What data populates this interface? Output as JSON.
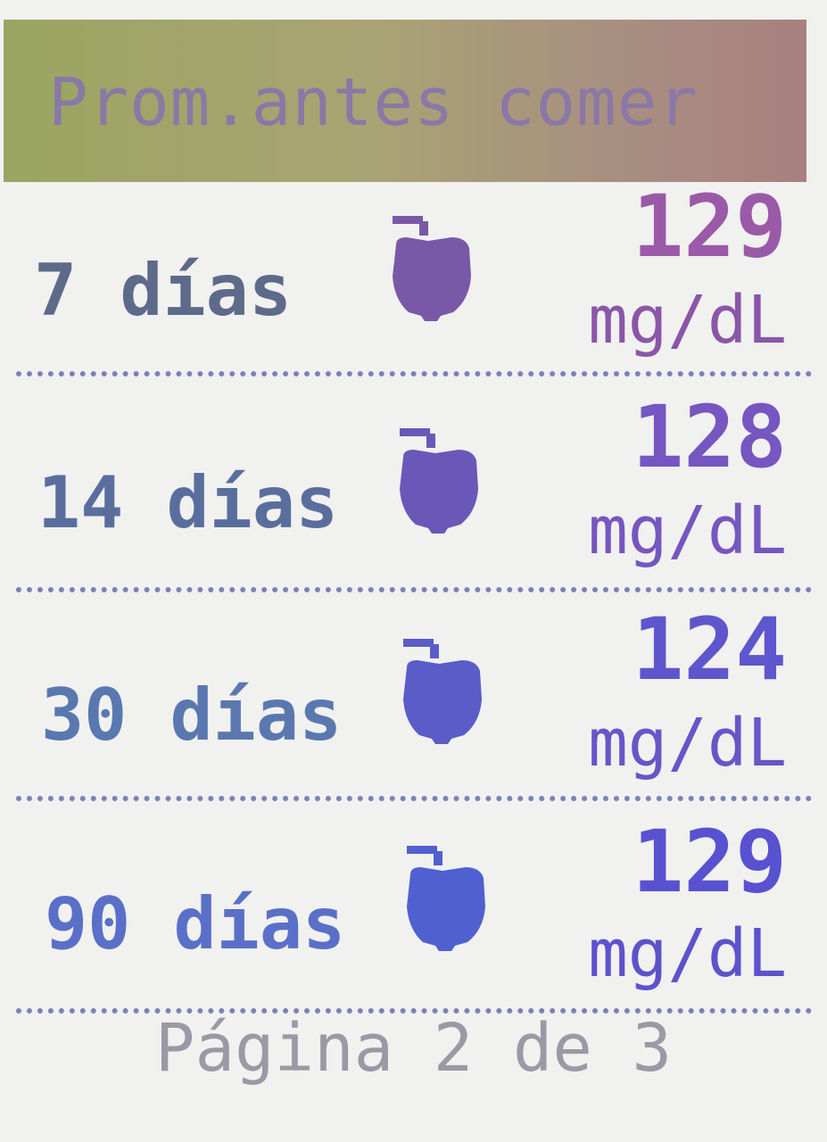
{
  "header": {
    "title": "Prom.antes comer"
  },
  "rows": [
    {
      "period": "7 días",
      "value": "129",
      "unit": "mg/dL",
      "icon": "apple-icon"
    },
    {
      "period": "14 días",
      "value": "128",
      "unit": "mg/dL",
      "icon": "apple-icon"
    },
    {
      "period": "30 días",
      "value": "124",
      "unit": "mg/dL",
      "icon": "apple-icon"
    },
    {
      "period": "90 días",
      "value": "129",
      "unit": "mg/dL",
      "icon": "apple-icon"
    }
  ],
  "footer": {
    "page_indicator": "Página 2 de 3"
  },
  "colors": {
    "header_start": "#9aa561",
    "header_end": "#a8807f",
    "label_row1": "#5c6c8c",
    "value_row1": "#8a5aa8",
    "accent_blue": "#5c5cd0",
    "divider": "#7a82b8"
  }
}
